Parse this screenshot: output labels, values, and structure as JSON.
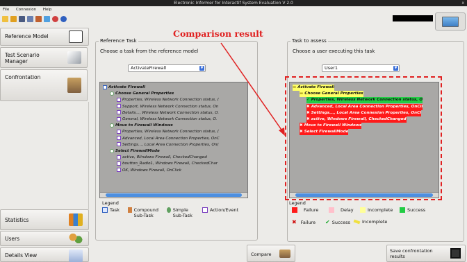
{
  "window": {
    "title": "Electronic Informer for Interactif System Evaluation V 2.0",
    "close": "x"
  },
  "menu": [
    "File",
    "Connexion",
    "Help"
  ],
  "sidebar": {
    "reference_model": "Reference Model",
    "test_scenario": "Test Scenario Manager",
    "confrontation": "Confrontation",
    "statistics": "Statistics",
    "users": "Users",
    "details_view": "Details View"
  },
  "annotation": "Comparison result",
  "reference": {
    "group_title": "Reference Task",
    "prompt": "Choose a task from the reference model",
    "selected": "ActivateFirewall",
    "tree": [
      {
        "text": "Activate Firewall",
        "level": 0,
        "bold": true
      },
      {
        "text": "Choose General Properties",
        "level": 1,
        "bold": true
      },
      {
        "text": "Properties, Wireless Network Connection status, (",
        "level": 2
      },
      {
        "text": "Support, Wireless Network Connection status, On",
        "level": 2
      },
      {
        "text": "Details..., Wireless Network Connection status, O.",
        "level": 2
      },
      {
        "text": "General, Wireless Network Connection status, O.",
        "level": 2
      },
      {
        "text": "Move to Firewall Windows",
        "level": 1,
        "bold": true
      },
      {
        "text": "Properties, Wireless Network Connection status, (",
        "level": 2
      },
      {
        "text": "Advanced, Local Area Connection Properties, OnC",
        "level": 2
      },
      {
        "text": "Settings..., Local Area Connection Properties, On(",
        "level": 2
      },
      {
        "text": "Select FirewallMode",
        "level": 1,
        "bold": true
      },
      {
        "text": "active, Windows Firewall, CheckedChanged",
        "level": 2
      },
      {
        "text": "boutton_Radio1, Windows Firewall, CheckedChar",
        "level": 2
      },
      {
        "text": "OK, Windows Firewall, OnClick",
        "level": 2
      }
    ],
    "legend_title": "Legend",
    "legend": [
      "Task",
      "Compound Sub-Task",
      "Simple Sub-Task",
      "Action/Event"
    ]
  },
  "assess": {
    "group_title": "Task to assess",
    "prompt": "Choose a user executing this task",
    "selected": "User1",
    "tree": [
      {
        "text": "Activate Firewall",
        "level": 0,
        "status": "incomplete"
      },
      {
        "text": "Choose General Properties",
        "level": 1,
        "status": "incomplete"
      },
      {
        "text": "Properties, Wireless Network Connection status, O",
        "level": 2,
        "status": "success"
      },
      {
        "text": "Advanced, Local Area Connection Properties, OnCli",
        "level": 2,
        "status": "failure"
      },
      {
        "text": "Settings..., Local Area Connexion Properties, OnCl",
        "level": 2,
        "status": "failure"
      },
      {
        "text": "active, Windows Firewall, CheckedChanged",
        "level": 2,
        "status": "failure"
      },
      {
        "text": "Move to Firewall Windows",
        "level": 1,
        "status": "failure"
      },
      {
        "text": "Select FirewallMode",
        "level": 1,
        "status": "failure"
      }
    ],
    "legend_title": "Legend",
    "legend_colors": [
      "Failure",
      "Delay",
      "Incomplete",
      "Success"
    ],
    "legend_icons": [
      "Failure",
      "Success",
      "Incomplete"
    ]
  },
  "colors": {
    "failure": "#ff1a1a",
    "delay": "#ffc0cb",
    "incomplete": "#ffff66",
    "success": "#22cc44",
    "annotation": "#e02020"
  },
  "bottom": {
    "compare": "Compare",
    "save": "Save confrontation results"
  }
}
